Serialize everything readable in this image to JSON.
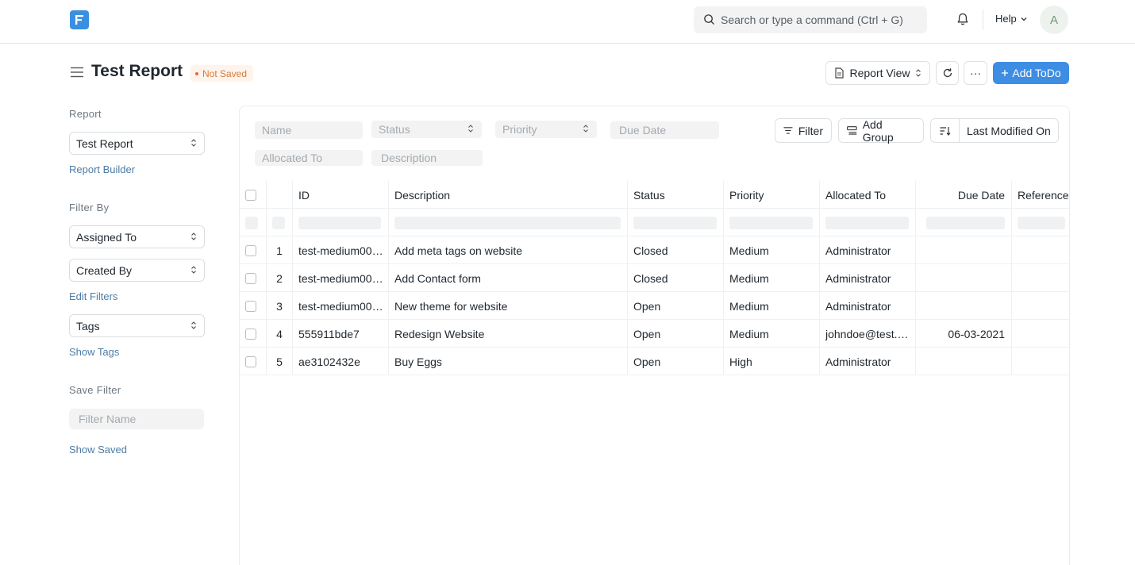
{
  "navbar": {
    "search_placeholder": "Search or type a command (Ctrl + G)",
    "help_label": "Help",
    "avatar_initial": "A"
  },
  "page": {
    "title": "Test Report",
    "status_badge": "Not Saved",
    "report_view_label": "Report View",
    "more_label": "···",
    "add_button_label": "Add ToDo"
  },
  "sidebar": {
    "report_heading": "Report",
    "report_select": "Test Report",
    "report_builder_link": "Report Builder",
    "filter_by_heading": "Filter By",
    "assigned_to_select": "Assigned To",
    "created_by_select": "Created By",
    "edit_filters_link": "Edit Filters",
    "tags_select": "Tags",
    "show_tags_link": "Show Tags",
    "save_filter_heading": "Save Filter",
    "filter_name_placeholder": "Filter Name",
    "show_saved_link": "Show Saved"
  },
  "filters": {
    "name": "Name",
    "status": "Status",
    "priority": "Priority",
    "due_date": "Due Date",
    "allocated_to": "Allocated To",
    "description": "Description",
    "filter_button": "Filter",
    "add_group_button": "Add Group",
    "sort_label": "Last Modified On"
  },
  "table": {
    "columns": {
      "id": "ID",
      "description": "Description",
      "status": "Status",
      "priority": "Priority",
      "allocated_to": "Allocated To",
      "due_date": "Due Date",
      "reference": "Reference"
    },
    "rows": [
      {
        "n": "1",
        "id": "test-medium00…",
        "description": "Add meta tags on website",
        "status": "Closed",
        "priority": "Medium",
        "allocated_to": "Administrator",
        "due_date": ""
      },
      {
        "n": "2",
        "id": "test-medium00…",
        "description": "Add Contact form",
        "status": "Closed",
        "priority": "Medium",
        "allocated_to": "Administrator",
        "due_date": ""
      },
      {
        "n": "3",
        "id": "test-medium00…",
        "description": "New theme for website",
        "status": "Open",
        "priority": "Medium",
        "allocated_to": "Administrator",
        "due_date": ""
      },
      {
        "n": "4",
        "id": "555911bde7",
        "description": "Redesign Website",
        "status": "Open",
        "priority": "Medium",
        "allocated_to": "johndoe@test.…",
        "due_date": "06-03-2021"
      },
      {
        "n": "5",
        "id": "ae3102432e",
        "description": "Buy Eggs",
        "status": "Open",
        "priority": "High",
        "allocated_to": "Administrator",
        "due_date": ""
      }
    ]
  },
  "colors": {
    "primary": "#3d8de3",
    "logo": "#3b8fe0",
    "badge_text": "#d37b3c",
    "link": "#4d7ca6"
  }
}
